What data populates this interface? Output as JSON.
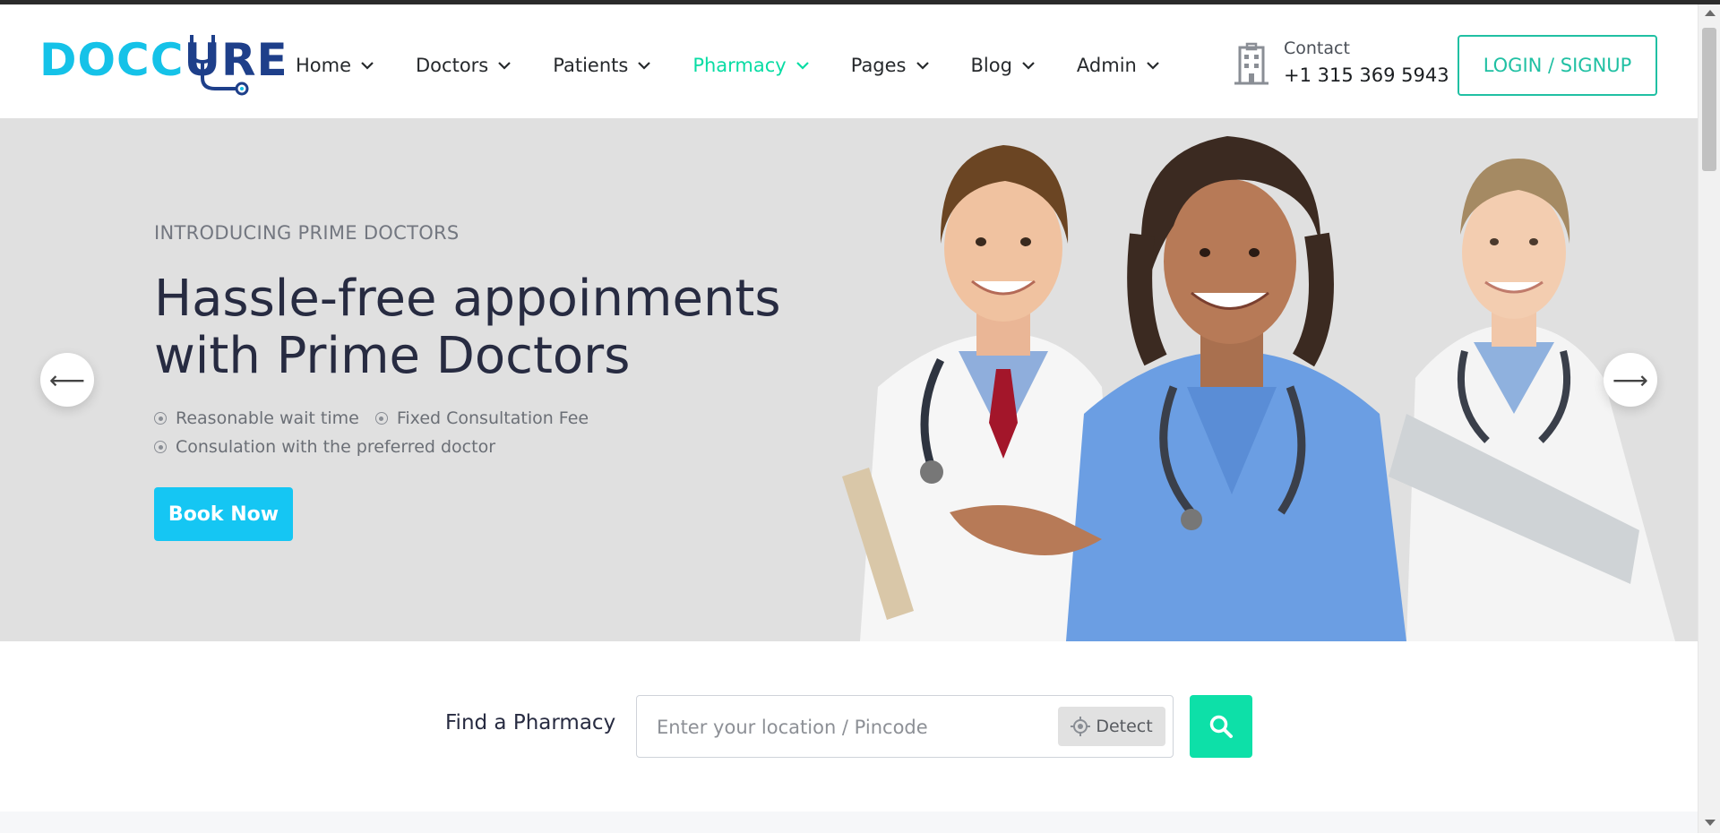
{
  "brand": {
    "logo_text_a": "DOCC",
    "logo_text_b": "URE",
    "logo_light_color": "#15c2e8",
    "logo_dark_color": "#1e3f8a"
  },
  "nav": {
    "items": [
      {
        "label": "Home",
        "active": false
      },
      {
        "label": "Doctors",
        "active": false
      },
      {
        "label": "Patients",
        "active": false
      },
      {
        "label": "Pharmacy",
        "active": true
      },
      {
        "label": "Pages",
        "active": false
      },
      {
        "label": "Blog",
        "active": false
      },
      {
        "label": "Admin",
        "active": false
      }
    ],
    "active_color": "#09dca4"
  },
  "contact": {
    "icon": "hospital-building-icon",
    "label": "Contact",
    "phone": "+1 315 369 5943"
  },
  "login": {
    "label": "LOGIN / SIGNUP",
    "color": "#20c0a3"
  },
  "hero": {
    "eyebrow": "INTRODUCING PRIME DOCTORS",
    "title_line1": "Hassle-free appoinments",
    "title_line2": "with Prime Doctors",
    "features": [
      "Reasonable wait time",
      "Fixed Consultation Fee",
      "Consulation with the preferred doctor"
    ],
    "cta_label": "Book Now",
    "cta_color": "#15c6f3",
    "prev_icon": "arrow-left-icon",
    "next_icon": "arrow-right-icon",
    "prev_glyph": "⟵",
    "next_glyph": "⟶"
  },
  "pharmacy_search": {
    "label": "Find a Pharmacy",
    "placeholder": "Enter your location / Pincode",
    "value": "",
    "detect_label": "Detect",
    "search_icon": "search-icon",
    "button_color": "#0de0a8"
  }
}
